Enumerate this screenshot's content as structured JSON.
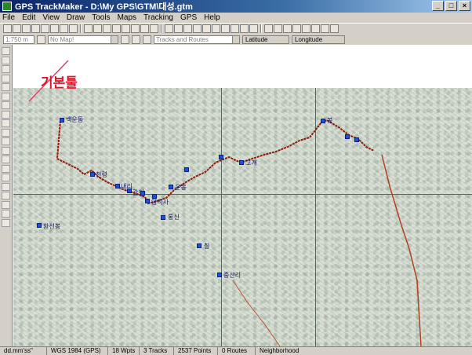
{
  "window": {
    "title": "GPS TrackMaker - D:\\My GPS\\GTM\\대성.gtm",
    "minimize": "_",
    "maximize": "□",
    "close": "×"
  },
  "menu": [
    "File",
    "Edit",
    "View",
    "Draw",
    "Tools",
    "Maps",
    "Tracking",
    "GPS",
    "Help"
  ],
  "toolbar2": {
    "scale": "1:750 m",
    "map_select": "No Map!",
    "tracks_routes": "Tracks and Routes",
    "latitude_label": "Latitude",
    "longitude_label": "Longitude"
  },
  "annotation": {
    "text": "기본툴",
    "color": "#e0142a"
  },
  "waypoints": [
    {
      "label": "백운동"
    },
    {
      "label": "천령"
    },
    {
      "label": "내리"
    },
    {
      "label": "갈현"
    },
    {
      "label": "운봉"
    },
    {
      "label": "양직사"
    },
    {
      "label": "통신"
    },
    {
      "label": "환선봉"
    },
    {
      "label": "칠"
    },
    {
      "label": "중산리"
    },
    {
      "label": "고개"
    },
    {
      "label": "봉"
    }
  ],
  "colors": {
    "track": "#8a1a0a",
    "waypoint": "#1e4fd8",
    "titlebar": "#0a246a"
  },
  "status": {
    "format": "dd.mm'ss\"",
    "datum": "WGS 1984 (GPS)",
    "wpts": "18 Wpts",
    "tracks": "3 Tracks",
    "points": "2537 Points",
    "routes": "0 Routes",
    "neighborhood": "Neighborhood"
  }
}
